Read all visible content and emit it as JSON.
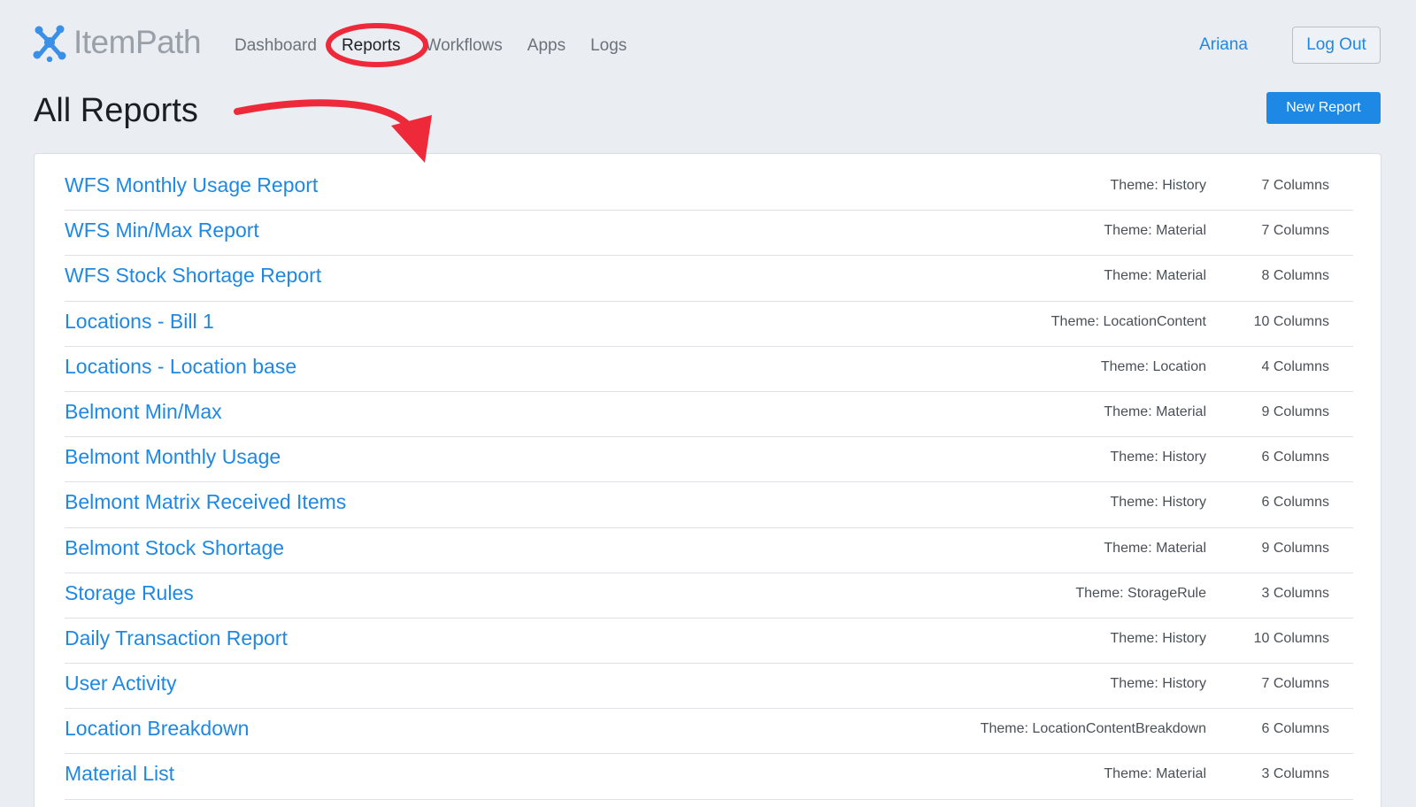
{
  "header": {
    "logo_text": "ItemPath",
    "nav": [
      {
        "label": "Dashboard"
      },
      {
        "label": "Reports"
      },
      {
        "label": "Workflows"
      },
      {
        "label": "Apps"
      },
      {
        "label": "Logs"
      }
    ],
    "user_name": "Ariana",
    "logout_label": "Log Out"
  },
  "page": {
    "title": "All Reports",
    "new_report_label": "New Report"
  },
  "colors": {
    "accent": "#1e88e5",
    "annotation": "#ee2a3a",
    "background": "#eaedf2"
  },
  "reports": [
    {
      "name": "WFS Monthly Usage Report",
      "theme": "Theme: History",
      "columns": "7 Columns"
    },
    {
      "name": "WFS Min/Max Report",
      "theme": "Theme: Material",
      "columns": "7 Columns"
    },
    {
      "name": "WFS Stock Shortage Report",
      "theme": "Theme: Material",
      "columns": "8 Columns"
    },
    {
      "name": "Locations - Bill 1",
      "theme": "Theme: LocationContent",
      "columns": "10 Columns"
    },
    {
      "name": "Locations - Location base",
      "theme": "Theme: Location",
      "columns": "4 Columns"
    },
    {
      "name": "Belmont Min/Max",
      "theme": "Theme: Material",
      "columns": "9 Columns"
    },
    {
      "name": "Belmont Monthly Usage",
      "theme": "Theme: History",
      "columns": "6 Columns"
    },
    {
      "name": "Belmont Matrix Received Items",
      "theme": "Theme: History",
      "columns": "6 Columns"
    },
    {
      "name": "Belmont Stock Shortage",
      "theme": "Theme: Material",
      "columns": "9 Columns"
    },
    {
      "name": "Storage Rules",
      "theme": "Theme: StorageRule",
      "columns": "3 Columns"
    },
    {
      "name": "Daily Transaction Report",
      "theme": "Theme: History",
      "columns": "10 Columns"
    },
    {
      "name": "User Activity",
      "theme": "Theme: History",
      "columns": "7 Columns"
    },
    {
      "name": "Location Breakdown",
      "theme": "Theme: LocationContentBreakdown",
      "columns": "6 Columns"
    },
    {
      "name": "Material List",
      "theme": "Theme: Material",
      "columns": "3 Columns"
    }
  ]
}
